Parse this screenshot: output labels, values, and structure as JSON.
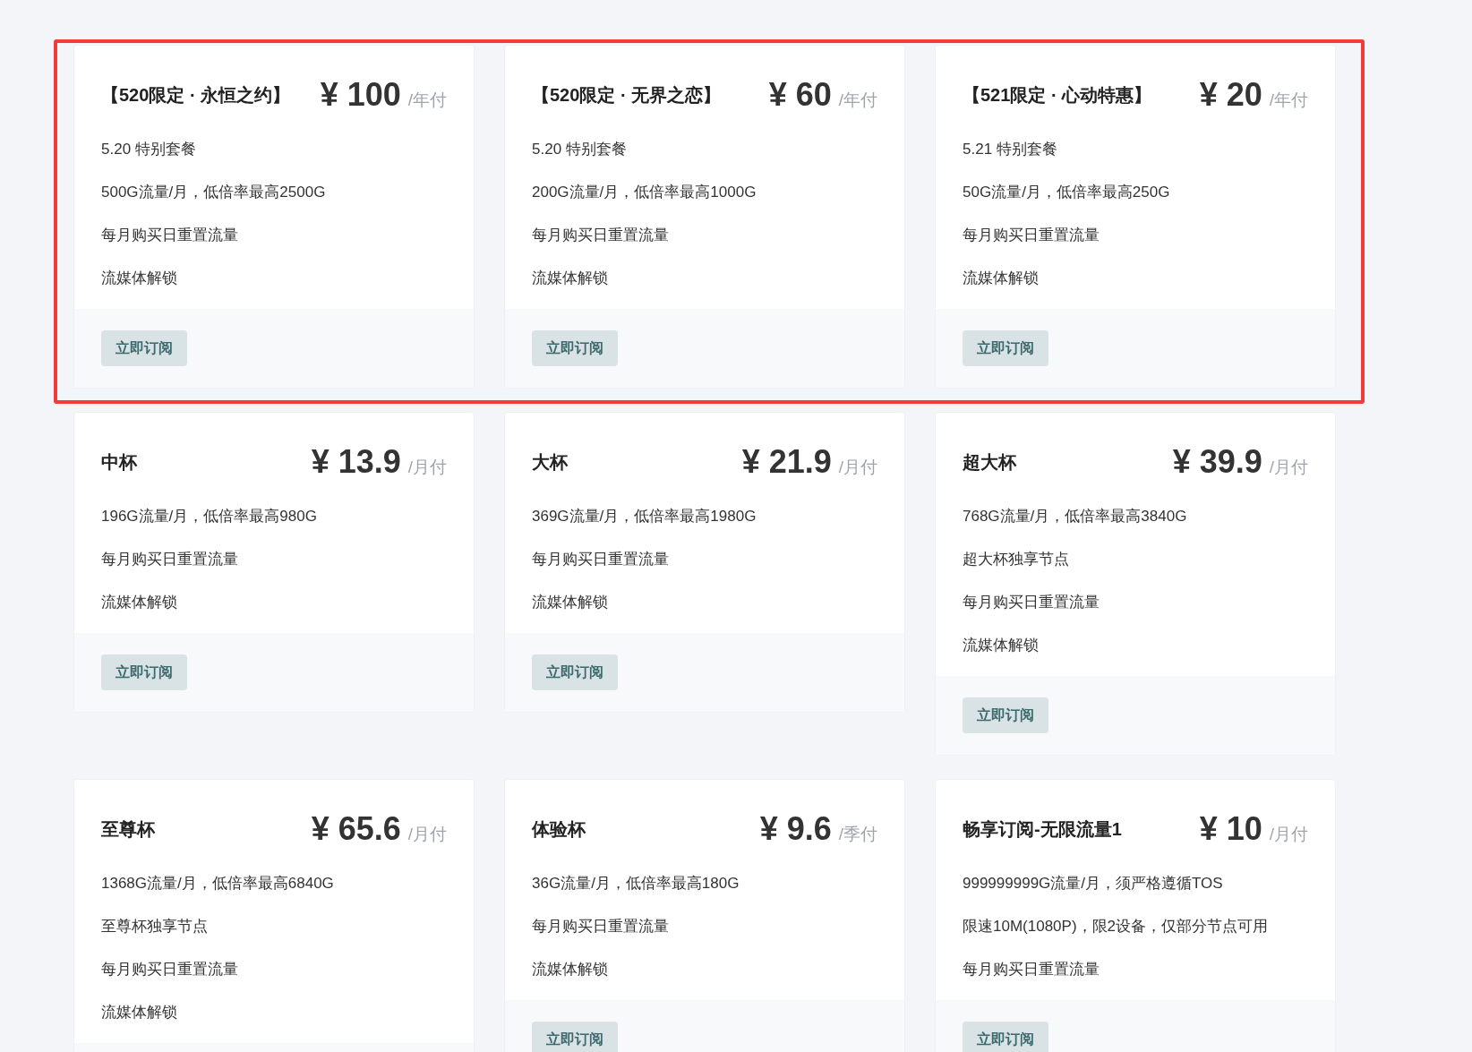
{
  "rows": [
    {
      "highlighted": true,
      "plans": [
        {
          "title": "【520限定 · 永恒之约】",
          "price": "¥ 100",
          "period": "/年付",
          "features": [
            "5.20 特别套餐",
            "500G流量/月，低倍率最高2500G",
            "每月购买日重置流量",
            "流媒体解锁"
          ],
          "button": "立即订阅"
        },
        {
          "title": "【520限定 · 无界之恋】",
          "price": "¥ 60",
          "period": "/年付",
          "features": [
            "5.20 特别套餐",
            "200G流量/月，低倍率最高1000G",
            "每月购买日重置流量",
            "流媒体解锁"
          ],
          "button": "立即订阅"
        },
        {
          "title": "【521限定 · 心动特惠】",
          "price": "¥ 20",
          "period": "/年付",
          "features": [
            "5.21 特别套餐",
            "50G流量/月，低倍率最高250G",
            "每月购买日重置流量",
            "流媒体解锁"
          ],
          "button": "立即订阅"
        }
      ]
    },
    {
      "highlighted": false,
      "plans": [
        {
          "title": "中杯",
          "price": "¥ 13.9",
          "period": "/月付",
          "features": [
            "196G流量/月，低倍率最高980G",
            "每月购买日重置流量",
            "流媒体解锁"
          ],
          "button": "立即订阅"
        },
        {
          "title": "大杯",
          "price": "¥ 21.9",
          "period": "/月付",
          "features": [
            "369G流量/月，低倍率最高1980G",
            "每月购买日重置流量",
            "流媒体解锁"
          ],
          "button": "立即订阅"
        },
        {
          "title": "超大杯",
          "price": "¥ 39.9",
          "period": "/月付",
          "features": [
            "768G流量/月，低倍率最高3840G",
            "超大杯独享节点",
            "每月购买日重置流量",
            "流媒体解锁"
          ],
          "button": "立即订阅"
        }
      ]
    },
    {
      "highlighted": false,
      "plans": [
        {
          "title": "至尊杯",
          "price": "¥ 65.6",
          "period": "/月付",
          "features": [
            "1368G流量/月，低倍率最高6840G",
            "至尊杯独享节点",
            "每月购买日重置流量",
            "流媒体解锁"
          ]
        },
        {
          "title": "体验杯",
          "price": "¥ 9.6",
          "period": "/季付",
          "features": [
            "36G流量/月，低倍率最高180G",
            "每月购买日重置流量",
            "流媒体解锁"
          ],
          "button": "立即订阅"
        },
        {
          "title": "畅享订阅-无限流量1",
          "price": "¥ 10",
          "period": "/月付",
          "features": [
            "999999999G流量/月，须严格遵循TOS",
            "限速10M(1080P)，限2设备，仅部分节点可用",
            "每月购买日重置流量"
          ],
          "button": "立即订阅"
        }
      ]
    }
  ]
}
